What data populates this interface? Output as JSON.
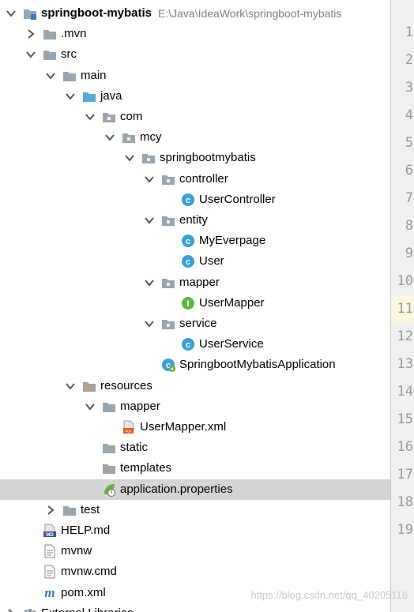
{
  "project_tree": {
    "rows": [
      {
        "label": "springboot-mybatis",
        "path": "E:\\Java\\IdeaWork\\springboot-mybatis",
        "bold": true,
        "depth": 0,
        "arrow": "down",
        "icon": "module-folder-icon"
      },
      {
        "label": ".mvn",
        "depth": 1,
        "arrow": "right",
        "icon": "folder-icon"
      },
      {
        "label": "src",
        "depth": 1,
        "arrow": "down",
        "icon": "folder-icon"
      },
      {
        "label": "main",
        "depth": 2,
        "arrow": "down",
        "icon": "folder-icon"
      },
      {
        "label": "java",
        "depth": 3,
        "arrow": "down",
        "icon": "source-folder-icon"
      },
      {
        "label": "com",
        "depth": 4,
        "arrow": "down",
        "icon": "package-icon"
      },
      {
        "label": "mcy",
        "depth": 5,
        "arrow": "down",
        "icon": "package-icon"
      },
      {
        "label": "springbootmybatis",
        "depth": 6,
        "arrow": "down",
        "icon": "package-icon"
      },
      {
        "label": "controller",
        "depth": 7,
        "arrow": "down",
        "icon": "package-icon"
      },
      {
        "label": "UserController",
        "depth": 8,
        "arrow": "none",
        "icon": "class-icon"
      },
      {
        "label": "entity",
        "depth": 7,
        "arrow": "down",
        "icon": "package-icon"
      },
      {
        "label": "MyEverpage",
        "depth": 8,
        "arrow": "none",
        "icon": "class-icon"
      },
      {
        "label": "User",
        "depth": 8,
        "arrow": "none",
        "icon": "class-icon"
      },
      {
        "label": "mapper",
        "depth": 7,
        "arrow": "down",
        "icon": "package-icon"
      },
      {
        "label": "UserMapper",
        "depth": 8,
        "arrow": "none",
        "icon": "interface-icon"
      },
      {
        "label": "service",
        "depth": 7,
        "arrow": "down",
        "icon": "package-icon"
      },
      {
        "label": "UserService",
        "depth": 8,
        "arrow": "none",
        "icon": "class-icon"
      },
      {
        "label": "SpringbootMybatisApplication",
        "depth": 7,
        "arrow": "none",
        "icon": "spring-boot-class-icon"
      },
      {
        "label": "resources",
        "depth": 3,
        "arrow": "down",
        "icon": "resources-folder-icon"
      },
      {
        "label": "mapper",
        "depth": 4,
        "arrow": "down",
        "icon": "folder-icon"
      },
      {
        "label": "UserMapper.xml",
        "depth": 5,
        "arrow": "none",
        "icon": "xml-file-icon"
      },
      {
        "label": "static",
        "depth": 4,
        "arrow": "none",
        "icon": "folder-icon"
      },
      {
        "label": "templates",
        "depth": 4,
        "arrow": "none",
        "icon": "folder-icon"
      },
      {
        "label": "application.properties",
        "depth": 4,
        "arrow": "none",
        "icon": "spring-properties-icon",
        "selected": true
      },
      {
        "label": "test",
        "depth": 2,
        "arrow": "right",
        "icon": "folder-icon"
      },
      {
        "label": "HELP.md",
        "depth": 1,
        "arrow": "none",
        "icon": "markdown-file-icon"
      },
      {
        "label": "mvnw",
        "depth": 1,
        "arrow": "none",
        "icon": "text-file-icon"
      },
      {
        "label": "mvnw.cmd",
        "depth": 1,
        "arrow": "none",
        "icon": "text-file-icon"
      },
      {
        "label": "pom.xml",
        "depth": 1,
        "arrow": "none",
        "icon": "maven-icon"
      },
      {
        "label": "External Libraries",
        "depth": 0,
        "arrow": "right",
        "icon": "libraries-icon"
      }
    ]
  },
  "gutter": {
    "lines": [
      "1",
      "2",
      "3",
      "4",
      "5",
      "6",
      "7",
      "8",
      "9",
      "10",
      "11",
      "12",
      "13",
      "14",
      "15",
      "16",
      "17",
      "18",
      "19"
    ],
    "current_line": "11"
  },
  "watermark": "https://blog.csdn.net/qq_40205116",
  "colors": {
    "folder": "#9aa5ad",
    "source_folder": "#5aa8d6",
    "class": "#3d9fd6",
    "interface": "#62b543",
    "selection": "#d4d4d4",
    "maven": "#3875c2"
  }
}
